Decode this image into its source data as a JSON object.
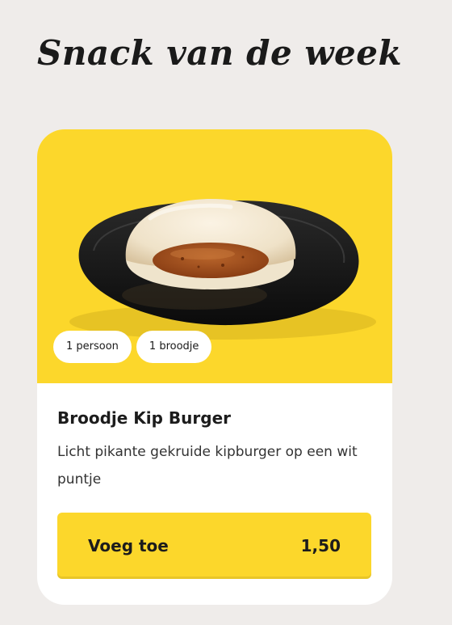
{
  "section": {
    "heading": "Snack van de week"
  },
  "product": {
    "image": "broodje-kip-burger-photo",
    "tags": [
      "1 persoon",
      "1 broodje"
    ],
    "name": "Broodje Kip Burger",
    "description": "Licht pikante gekruide kipburger op een wit puntje",
    "add_label": "Voeg toe",
    "price": "1,50"
  },
  "colors": {
    "background": "#efecea",
    "accent": "#fcd72b",
    "card": "#ffffff",
    "text": "#1c1c1c"
  }
}
